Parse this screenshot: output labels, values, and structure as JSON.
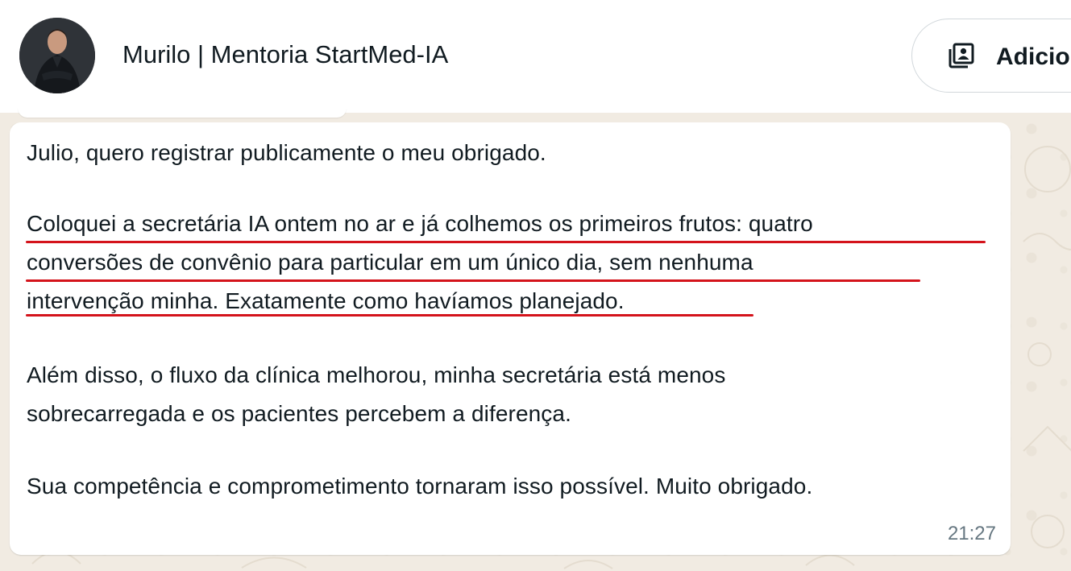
{
  "header": {
    "contact_name": "Murilo | Mentoria StartMed-IA",
    "add_button_label": "Adicio"
  },
  "message": {
    "lines": [
      "Julio, quero registrar publicamente o meu obrigado.",
      "Coloquei a secretária IA ontem no ar e já colhemos os primeiros frutos: quatro",
      "conversões de convênio para particular em um único dia, sem nenhuma",
      "intervenção minha. Exatamente como havíamos planejado.",
      "Além disso, o fluxo da clínica melhorou, minha secretária está menos",
      "sobrecarregada e os pacientes percebem a diferença.",
      "Sua competência e comprometimento tornaram isso possível. Muito obrigado."
    ],
    "time": "21:27"
  },
  "colors": {
    "underline": "#d4131b",
    "text": "#111b21",
    "timestamp": "#667781"
  },
  "icons": [
    "contact-card-icon"
  ]
}
